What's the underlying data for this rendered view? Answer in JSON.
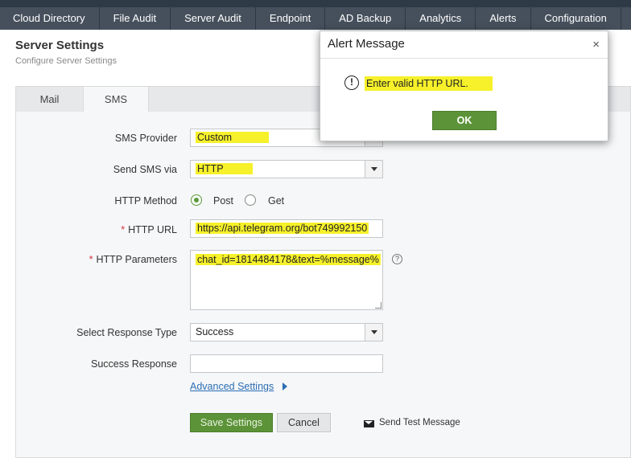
{
  "nav": {
    "items": [
      "Cloud Directory",
      "File Audit",
      "Server Audit",
      "Endpoint",
      "AD Backup",
      "Analytics",
      "Alerts",
      "Configuration"
    ]
  },
  "header": {
    "title": "Server Settings",
    "subtitle": "Configure Server Settings"
  },
  "tabs": {
    "mail": "Mail",
    "sms": "SMS",
    "active": "SMS"
  },
  "form": {
    "sms_provider_label": "SMS Provider",
    "sms_provider_value": "Custom",
    "send_via_label": "Send SMS via",
    "send_via_value": "HTTP",
    "http_method_label": "HTTP Method",
    "method_post": "Post",
    "method_get": "Get",
    "method_selected": "Post",
    "http_url_label": "HTTP URL",
    "http_url_value": "https://api.telegram.org/bot749992150",
    "http_params_label": "HTTP Parameters",
    "http_params_value": "chat_id=1814484178&text=%message%",
    "response_type_label": "Select Response Type",
    "response_type_value": "Success",
    "success_response_label": "Success  Response",
    "success_response_value": "",
    "advanced_link": "Advanced Settings",
    "required_mark": "*",
    "help_glyph": "?"
  },
  "actions": {
    "save": "Save Settings",
    "cancel": "Cancel",
    "send_test": "Send Test Message"
  },
  "modal": {
    "title": "Alert Message",
    "close_glyph": "×",
    "warning_glyph": "!",
    "message": "Enter valid HTTP URL.",
    "ok": "OK"
  },
  "colors": {
    "nav_bg": "#46505c",
    "primary_button": "#5c9338",
    "highlight": "#f6f12a",
    "link": "#2a6db5",
    "required": "#d9333f"
  },
  "icons": [
    "warning-icon",
    "close-icon",
    "dropdown-arrow-icon",
    "help-icon",
    "chevron-right-icon",
    "mail-icon"
  ]
}
